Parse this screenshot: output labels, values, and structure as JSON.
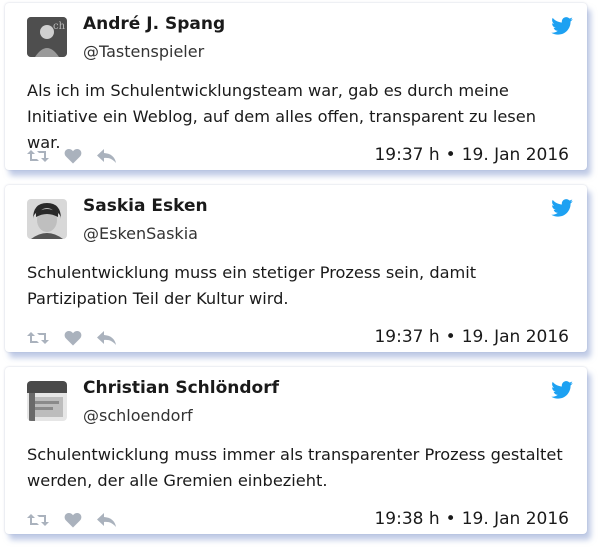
{
  "tweets": [
    {
      "name": "André J. Spang",
      "handle": "@Tastenspieler",
      "text": "Als ich im Schulentwicklungsteam war, gab es durch meine Initiative ein Weblog, auf dem alles offen, transparent zu lesen war.",
      "time": "19:37 h",
      "date": "19. Jan 2016"
    },
    {
      "name": "Saskia Esken",
      "handle": "@EskenSaskia",
      "text": "Schulentwicklung muss ein stetiger Prozess sein, damit Partizipation Teil der Kultur wird.",
      "time": "19:37 h",
      "date": "19. Jan 2016"
    },
    {
      "name": "Christian Schlöndorf",
      "handle": "@schloendorf",
      "text": "Schulentwicklung muss immer als transparenter Prozess gestaltet werden, der alle Gremien einbezieht.",
      "time": "19:38 h",
      "date": "19. Jan 2016"
    }
  ],
  "separator": "•",
  "icons": {
    "brand": "twitter-bird-icon",
    "retweet": "retweet-icon",
    "like": "heart-icon",
    "reply": "reply-icon"
  },
  "colors": {
    "twitter_blue": "#1DA1F2",
    "action_gray": "#aab2bd",
    "text": "#1a1a1a"
  }
}
